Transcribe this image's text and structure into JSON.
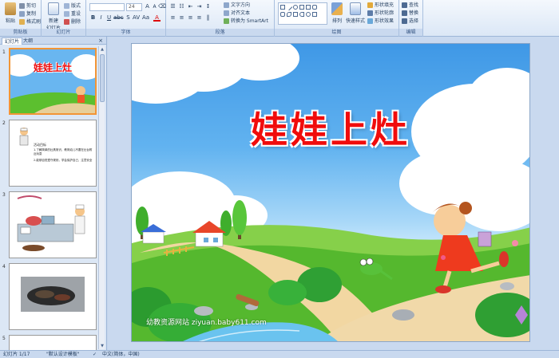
{
  "ribbon": {
    "clipboard": {
      "paste": "粘贴",
      "cut": "剪切",
      "copy": "复制",
      "format_painter": "格式刷",
      "label": "剪贴板"
    },
    "slides": {
      "new_slide": "新建\n幻灯片",
      "layout": "版式",
      "reset": "重设",
      "delete": "删除",
      "label": "幻灯片"
    },
    "font": {
      "name": "",
      "size": "24",
      "label": "字体"
    },
    "paragraph": {
      "text_direction": "文字方向",
      "align_text": "对齐文本",
      "smartart": "转换为 SmartArt",
      "label": "段落"
    },
    "drawing": {
      "arrange": "排列",
      "quick_styles": "快速样式",
      "shape_fill": "形状填充",
      "shape_outline": "形状轮廓",
      "shape_effects": "形状效果",
      "label": "绘图"
    },
    "editing": {
      "find": "查找",
      "replace": "替换",
      "select": "选择",
      "label": "编辑"
    }
  },
  "panel": {
    "tabs": [
      "幻灯片",
      "大纲"
    ],
    "close": "×",
    "thumbnails": [
      {
        "num": "1",
        "title": "娃娃上灶"
      },
      {
        "num": "2",
        "lines": [
          "活动目标",
          "1.了解简单的灶具常识，教育幼儿不要在灶台附近玩耍",
          "2.能够自觉遵守规则，学会保护自己，注意安全"
        ]
      },
      {
        "num": "3"
      },
      {
        "num": "4"
      },
      {
        "num": "5"
      }
    ]
  },
  "slide": {
    "title": "娃娃上灶",
    "watermark": "幼教资源网站 ziyuan.baby611.com"
  },
  "status": {
    "slide_count": "幻灯片 1/17",
    "theme": "\"默认设计模板\"",
    "language": "中文(简体，中国)"
  },
  "colors": {
    "ribbon_bg": "#dbe7f6",
    "title_red": "#f00c0c",
    "sky_blue": "#62b3f0",
    "grass_green": "#55b82e",
    "selection_orange": "#f29536"
  }
}
